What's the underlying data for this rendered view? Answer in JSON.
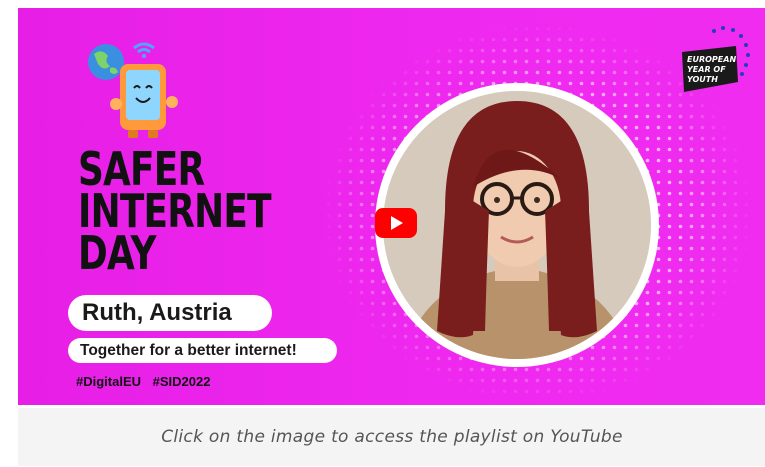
{
  "banner": {
    "title_lines": [
      "SAFER",
      "INTERNET",
      "DAY"
    ],
    "speaker": "Ruth, Austria",
    "slogan": "Together for a better internet!",
    "hashtags": [
      "#DigitalEU",
      "#SID2022"
    ],
    "logo_lines": [
      "EUROPEAN",
      "YEAR OF",
      "YOUTH"
    ],
    "play_icon": "youtube-play-icon",
    "mascot_icon": "tablet-mascot-with-globe",
    "colors": {
      "background": "#e61ee6",
      "text": "#111111",
      "pill": "#ffffff",
      "play_red": "#ff0000",
      "logo_bg": "#1a1a1a",
      "stars": "#1f3fbf"
    }
  },
  "caption": {
    "text": "Click on the image to access the playlist on YouTube"
  }
}
